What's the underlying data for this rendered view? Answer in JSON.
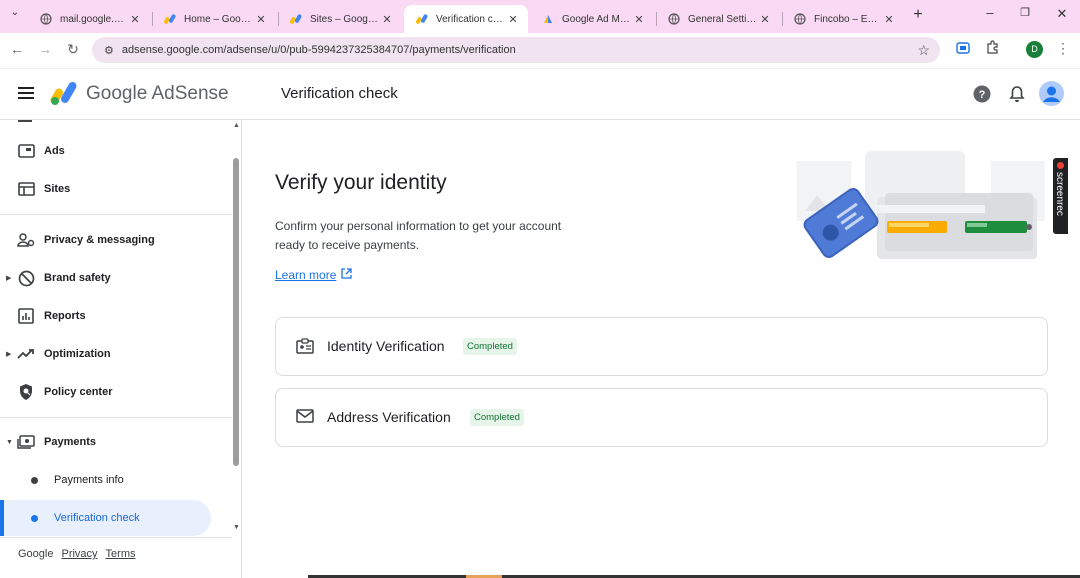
{
  "browser": {
    "tabs": [
      {
        "title": "mail.google.com",
        "active": false
      },
      {
        "title": "Home – Google",
        "active": false
      },
      {
        "title": "Sites – Google A",
        "active": false
      },
      {
        "title": "Verification chec",
        "active": true
      },
      {
        "title": "Google Ad Mana",
        "active": false
      },
      {
        "title": "General Settings",
        "active": false
      },
      {
        "title": "Fincobo – Everyt",
        "active": false
      }
    ],
    "url": "adsense.google.com/adsense/u/0/pub-5994237325384707/payments/verification",
    "profile_initial": "D",
    "colors": {
      "tabstrip": "#f9d9f4",
      "omnibox": "#f1e3ef",
      "profile": "#188038"
    }
  },
  "appbar": {
    "product_name": "Google AdSense",
    "page_title": "Verification check"
  },
  "sidebar": {
    "items": [
      {
        "label": "Ads",
        "icon": "ads-icon"
      },
      {
        "label": "Sites",
        "icon": "sites-icon"
      },
      {
        "label": "Privacy & messaging",
        "icon": "privacy-icon"
      },
      {
        "label": "Brand safety",
        "icon": "block-icon"
      },
      {
        "label": "Reports",
        "icon": "reports-icon"
      },
      {
        "label": "Optimization",
        "icon": "optimization-icon"
      },
      {
        "label": "Policy center",
        "icon": "policy-icon"
      },
      {
        "label": "Payments",
        "icon": "payments-icon"
      },
      {
        "label": "Payments info",
        "icon": "dot"
      },
      {
        "label": "Verification check",
        "icon": "dot",
        "selected": true
      }
    ],
    "footer": {
      "brand": "Google",
      "privacy": "Privacy",
      "terms": "Terms"
    }
  },
  "main": {
    "heading": "Verify your identity",
    "description_line1": "Confirm your personal information to get your account",
    "description_line2": "ready to receive payments.",
    "learn_more": "Learn more",
    "cards": [
      {
        "title": "Identity Verification",
        "status": "Completed",
        "icon": "id-card-icon"
      },
      {
        "title": "Address Verification",
        "status": "Completed",
        "icon": "mail-icon"
      }
    ]
  },
  "overlay": {
    "label": "screenrec"
  },
  "colors": {
    "accent": "#1a73e8",
    "selected_bg": "#e8f0fe",
    "badge_bg": "#e6f4ea",
    "badge_text": "#137333"
  }
}
